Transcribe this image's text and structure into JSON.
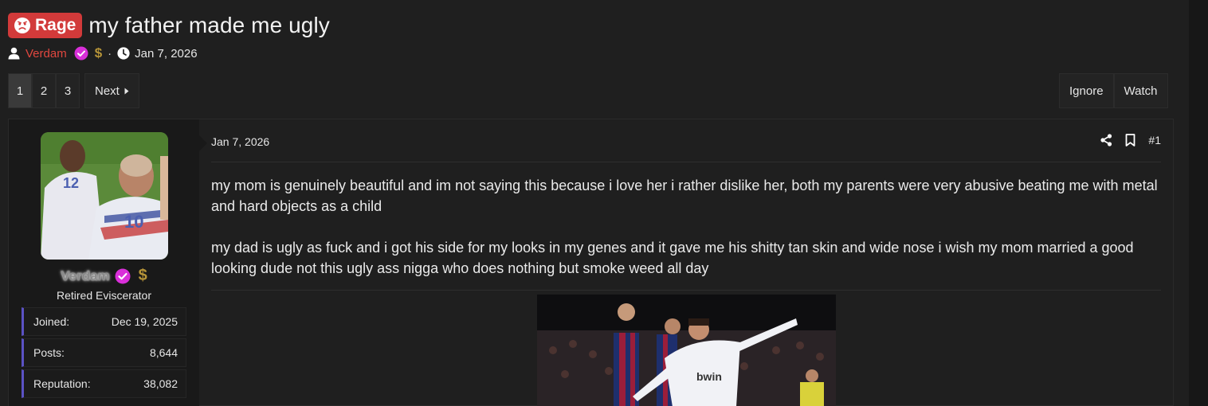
{
  "thread": {
    "prefix": "Rage",
    "title": "my father made me ugly",
    "author": "Verdam",
    "badge_symbol": "$",
    "separator": "·",
    "date": "Jan 7, 2026"
  },
  "pagination": {
    "pages": [
      "1",
      "2",
      "3"
    ],
    "current": "1",
    "next_label": "Next"
  },
  "actions": {
    "ignore": "Ignore",
    "watch": "Watch"
  },
  "post": {
    "user": {
      "name": "Verdam",
      "badge_symbol": "$",
      "title": "Retired Eviscerator",
      "stats": [
        {
          "label": "Joined:",
          "value": "Dec 19, 2025"
        },
        {
          "label": "Posts:",
          "value": "8,644"
        },
        {
          "label": "Reputation:",
          "value": "38,082"
        }
      ]
    },
    "date": "Jan 7, 2026",
    "number": "#1",
    "paragraphs": [
      "my mom is genuinely beautiful and im not saying this because i love her i rather dislike her, both my parents were very abusive beating me with metal and hard objects as a child",
      "my dad is ugly as fuck and i got his side for my looks in my genes and it gave me his shitty tan skin and wide nose i wish my mom married a good looking dude not this ugly ass nigga who does nothing but smoke weed all day"
    ]
  },
  "colors": {
    "prefix_bg": "#d23a3a",
    "author": "#e0473f",
    "verified": "#d92fd9",
    "stat_accent": "#5b52c4"
  },
  "icons": [
    "angry-face-icon",
    "user-icon",
    "verified-icon",
    "clock-icon",
    "caret-right-icon",
    "share-icon",
    "bookmark-icon"
  ]
}
